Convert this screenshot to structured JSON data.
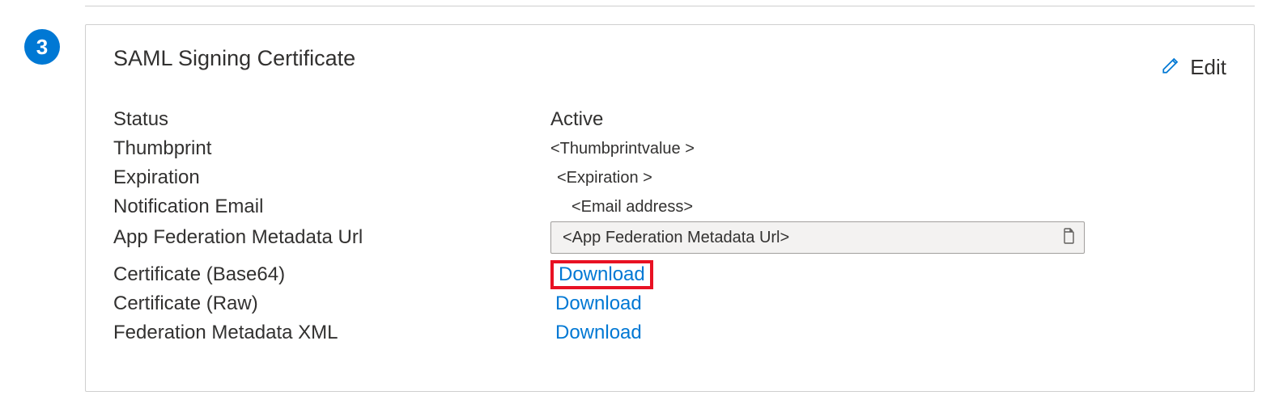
{
  "step_number": "3",
  "card": {
    "title": "SAML Signing Certificate",
    "edit_label": "Edit"
  },
  "fields": {
    "status_label": "Status",
    "status_value": "Active",
    "thumbprint_label": "Thumbprint",
    "thumbprint_value": "<Thumbprintvalue >",
    "expiration_label": "Expiration",
    "expiration_value": "<Expiration >",
    "notification_email_label": "Notification Email",
    "notification_email_value": "<Email address>",
    "metadata_url_label": "App Federation Metadata Url",
    "metadata_url_value": "<App Federation Metadata Url>",
    "cert_base64_label": "Certificate (Base64)",
    "cert_base64_link": "Download",
    "cert_raw_label": "Certificate (Raw)",
    "cert_raw_link": "Download",
    "fed_xml_label": "Federation Metadata XML",
    "fed_xml_link": "Download"
  }
}
